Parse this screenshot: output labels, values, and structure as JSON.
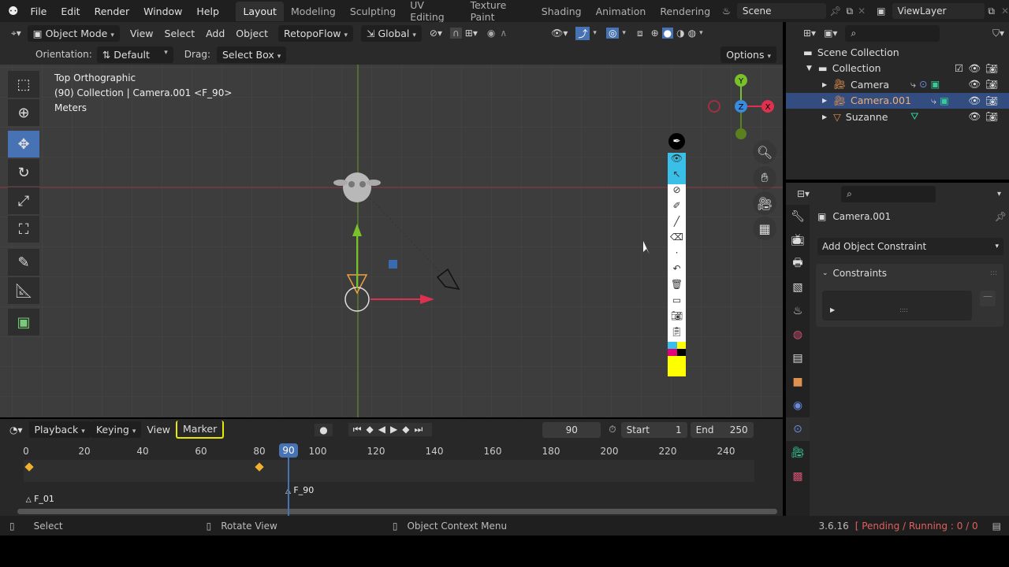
{
  "topbar": {
    "menus": [
      "File",
      "Edit",
      "Render",
      "Window",
      "Help"
    ],
    "workspaces": [
      "Layout",
      "Modeling",
      "Sculpting",
      "UV Editing",
      "Texture Paint",
      "Shading",
      "Animation",
      "Rendering"
    ],
    "active_workspace": "Layout",
    "scene": "Scene",
    "view_layer": "ViewLayer"
  },
  "viewport_header": {
    "mode": "Object Mode",
    "menus": [
      "View",
      "Select",
      "Add",
      "Object"
    ],
    "addon": "RetopoFlow",
    "transform_orientation": "Global"
  },
  "tool_settings": {
    "orientation_label": "Orientation:",
    "orientation_value": "Default",
    "drag_label": "Drag:",
    "drag_value": "Select Box",
    "options": "Options"
  },
  "viewport": {
    "view_name": "Top Orthographic",
    "context": "(90) Collection | Camera.001 <F_90>",
    "units": "Meters",
    "gizmo_axes": [
      "Y",
      "Z",
      "X"
    ]
  },
  "outliner": {
    "root": "Scene Collection",
    "collection": "Collection",
    "items": [
      {
        "name": "Camera",
        "selected": false
      },
      {
        "name": "Camera.001",
        "selected": true
      },
      {
        "name": "Suzanne",
        "selected": false
      }
    ]
  },
  "properties": {
    "object_name": "Camera.001",
    "add_constraint": "Add Object Constraint",
    "panel_title": "Constraints"
  },
  "timeline": {
    "menus": [
      "Playback",
      "Keying",
      "View",
      "Marker"
    ],
    "highlighted_menu": "Marker",
    "current_frame": "90",
    "start_label": "Start",
    "start": "1",
    "end_label": "End",
    "end": "250",
    "ticks": [
      "0",
      "20",
      "40",
      "60",
      "80",
      "100",
      "120",
      "140",
      "160",
      "180",
      "200",
      "220",
      "240"
    ],
    "keyframes": [
      1,
      80
    ],
    "markers": [
      {
        "name": "F_01",
        "frame": 1
      },
      {
        "name": "F_90",
        "frame": 90
      }
    ],
    "playhead_label": "90"
  },
  "status": {
    "left": "Select",
    "middle": "Rotate View",
    "right": "Object Context Menu",
    "version": "3.6.16",
    "job": "[ Pending / Running : 0 / 0"
  },
  "colors": {
    "accent": "#4772b3",
    "selected_row": "#334d80",
    "marker_highlight": "#e8e800",
    "keyframe": "#f0b030"
  }
}
